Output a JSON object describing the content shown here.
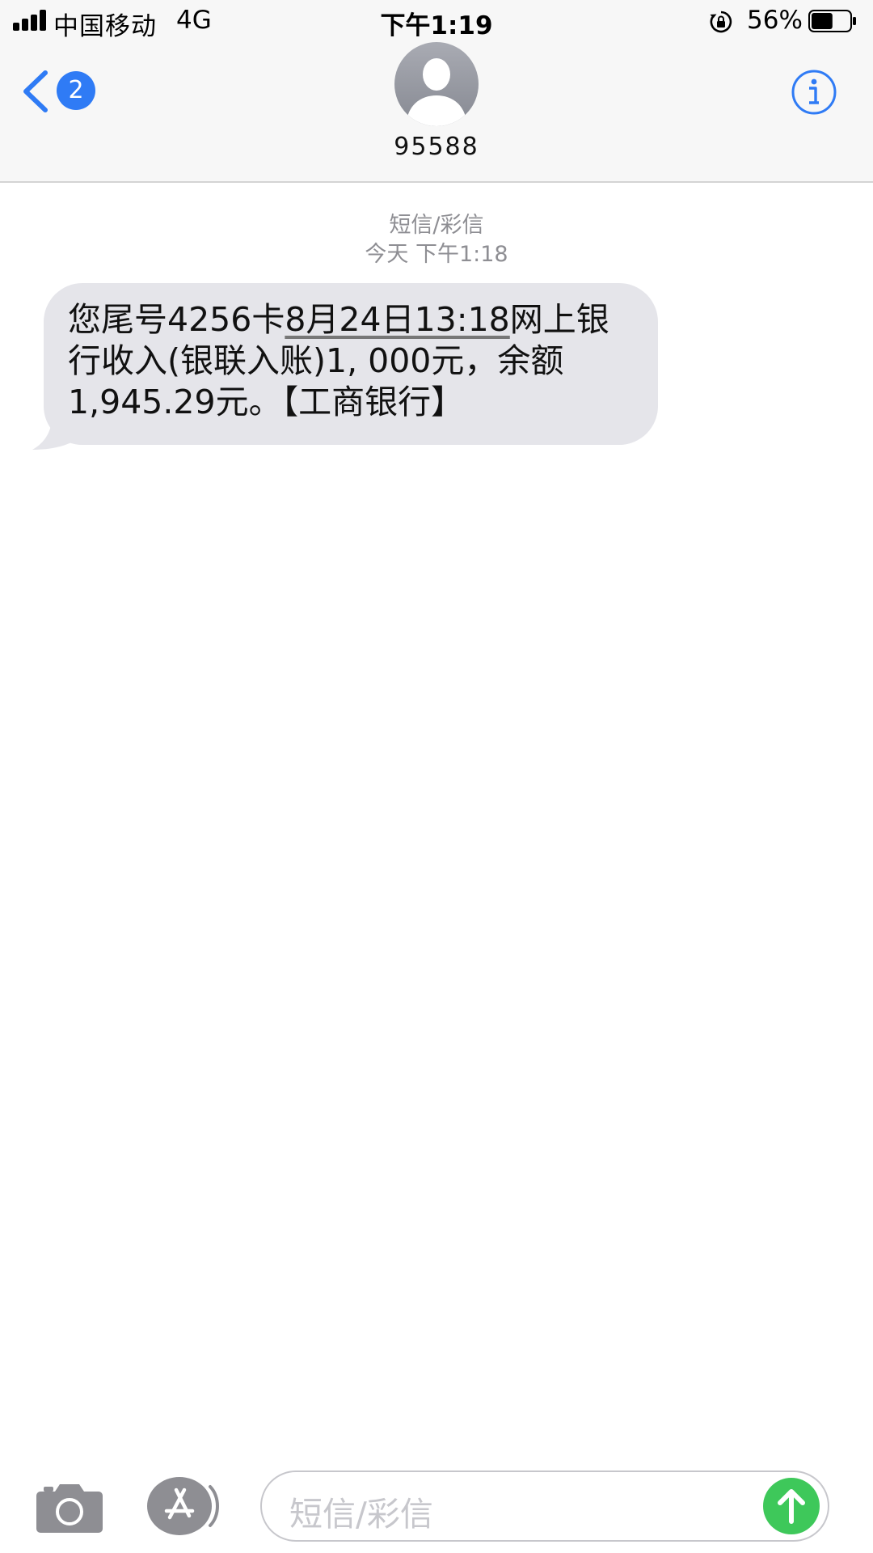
{
  "status_bar": {
    "carrier": "中国移动",
    "network": "4G",
    "time": "下午1:19",
    "battery_percent": "56%",
    "battery_level": 0.56
  },
  "header": {
    "back_badge_count": "2",
    "contact_name": "95588"
  },
  "conversation": {
    "message_type": "短信/彩信",
    "timestamp": "今天 下午1:18",
    "messages": [
      {
        "line1_prefix": "您尾号4256卡",
        "line1_date_link": "8月24日13:18",
        "line1_suffix": "网上银",
        "line2": "行收入(银联入账)1, 000元，余额",
        "line3": "1,945.29元。【工商银行】"
      }
    ]
  },
  "input_bar": {
    "placeholder": "短信/彩信"
  },
  "colors": {
    "accent_blue": "#2f7bf5",
    "bubble_gray": "#e5e5ea",
    "send_green": "#3ec85a",
    "secondary_text": "#8e8e93"
  }
}
